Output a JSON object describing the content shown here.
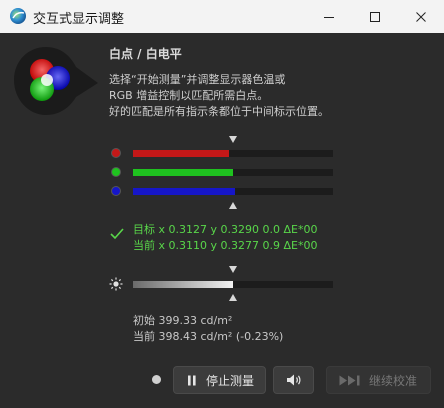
{
  "window": {
    "title": "交互式显示调整"
  },
  "header": {
    "heading": "白点 / 白电平",
    "desc_line1": "选择“开始测量”并调整显示器色温或",
    "desc_line2": "RGB 增益控制以匹配所需白点。",
    "desc_line3": "好的匹配是所有指示条都位于中间标示位置。"
  },
  "rgb_bars": {
    "red": {
      "color": "#c41818",
      "level": 0.48
    },
    "green": {
      "color": "#1fc21f",
      "level": 0.5
    },
    "blue": {
      "color": "#1616c8",
      "level": 0.51
    }
  },
  "measurement": {
    "target_line": "目标 x 0.3127 y 0.3290 0.0 ΔE*00",
    "current_line": "当前 x 0.3110 y 0.3277 0.9 ΔE*00",
    "accent": "#59d64a"
  },
  "luminance": {
    "level": 0.5,
    "initial_line": "初始 399.33 cd/m²",
    "current_line": "当前 398.43 cd/m² (-0.23%)"
  },
  "buttons": {
    "stop_label": "停止测量",
    "continue_label": "继续校准"
  },
  "icons": [
    "app-icon",
    "minimize-icon",
    "maximize-icon",
    "close-icon",
    "rgb-light-icon",
    "check-icon",
    "sun-icon",
    "pause-icon",
    "speaker-icon",
    "skip-forward-icon"
  ]
}
